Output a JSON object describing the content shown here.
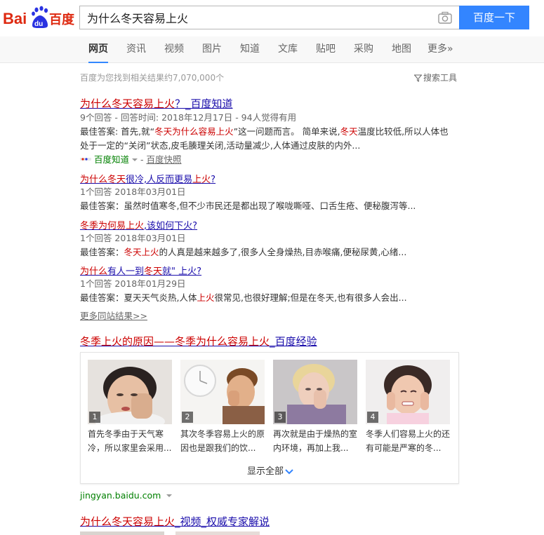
{
  "header": {
    "logo_text_bai": "Bai",
    "logo_text_du": "du",
    "logo_text_cn": "百度",
    "query": "为什么冬天容易上火",
    "search_button": "百度一下"
  },
  "tabs": [
    {
      "label": "网页",
      "active": true
    },
    {
      "label": "资讯"
    },
    {
      "label": "视频"
    },
    {
      "label": "图片"
    },
    {
      "label": "知道"
    },
    {
      "label": "文库"
    },
    {
      "label": "贴吧"
    },
    {
      "label": "采购"
    },
    {
      "label": "地图"
    },
    {
      "label": "更多»"
    }
  ],
  "meta": {
    "result_count": "百度为您找到相关结果约7,070,000个",
    "tools": "搜索工具"
  },
  "zhidao": {
    "title_em": "为什么冬天容易上火",
    "title_rest": "？_百度知道",
    "info": "9个回答 - 回答时间: 2018年12月17日 - 94人觉得有用",
    "ans_label": "最佳答案: 首先,就“",
    "ans_em1": "冬天为什么容易上火",
    "ans_mid": "”这一问题而言。 简单来说,",
    "ans_em2": "冬天",
    "ans_rest": "温度比较低,所以人体也",
    "ans_line2": "处于一定的“关闭”状态,皮毛腠理关闭,活动量减少,人体通过皮肤的内外...",
    "source": "百度知道",
    "snapshot": "百度快照",
    "sub": [
      {
        "t1": "为什么冬天",
        "t2": "很冷,人反而更易",
        "t3": "上火",
        "t4": "?",
        "info": "1个回答   2018年03月01日",
        "ans_a": "最佳答案：虽然时值寒冬,但不少市民还是都出现了喉咙嘶哑、口舌生疮、便秘腹泻等...",
        "ans_em": "",
        "ans_b": ""
      },
      {
        "t1": "冬季为何易",
        "t2": "",
        "t3": "上火",
        "t4": ",该如何下火?",
        "info": "1个回答   2018年03月01日",
        "ans_a": "最佳答案：",
        "ans_em": "冬天上火",
        "ans_b": "的人真是越来越多了,很多人全身燥热,目赤喉痛,便秘尿黄,心绪..."
      },
      {
        "t1": "为什么",
        "t2": "有人一到",
        "t3": "冬天",
        "t4": "就\" 上火?",
        "info": "1个回答   2018年01月29日",
        "ans_a": "最佳答案：夏天天气炎热,人体",
        "ans_em": "上火",
        "ans_b": "很常见,也很好理解;但是在冬天,也有很多人会出..."
      }
    ],
    "more": "更多同站结果>>"
  },
  "jingyan": {
    "title_a": "冬季",
    "title_b": "上火",
    "title_c": "的原因——",
    "title_d": "冬季为什么容易上火",
    "title_e": "_百度经验",
    "items": [
      {
        "num": "1",
        "cap": "首先冬季由于天气寒冷，所以家里会采用..."
      },
      {
        "num": "2",
        "cap": "其次冬季容易上火的原因也是跟我们的饮..."
      },
      {
        "num": "3",
        "cap": "再次就是由于燥热的室内环境，再加上我..."
      },
      {
        "num": "4",
        "cap": "冬季人们容易上火的还有可能是严寒的冬..."
      }
    ],
    "show_all": "显示全部",
    "domain": "jingyan.baidu.com"
  },
  "video": {
    "title_em": "为什么冬天容易上火",
    "title_rest": "_视频_权威专家解说"
  },
  "colors": {
    "accent": "#3385ff",
    "link": "#1a0dab",
    "highlight": "#cc0000",
    "url_green": "#008000"
  }
}
